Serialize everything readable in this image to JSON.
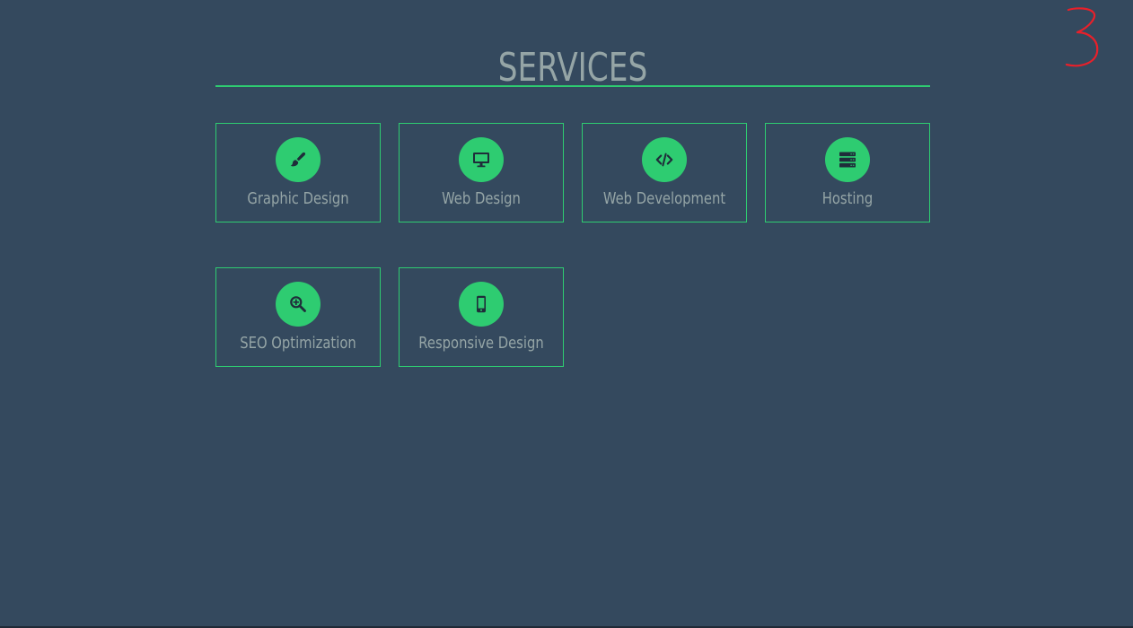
{
  "section": {
    "title": "SERVICES"
  },
  "services": [
    {
      "label": "Graphic Design",
      "icon": "paint-brush-icon"
    },
    {
      "label": "Web Design",
      "icon": "monitor-icon"
    },
    {
      "label": "Web Development",
      "icon": "code-icon"
    },
    {
      "label": "Hosting",
      "icon": "server-icon"
    },
    {
      "label": "SEO Optimization",
      "icon": "search-plus-icon"
    },
    {
      "label": "Responsive Design",
      "icon": "mobile-icon"
    }
  ],
  "colors": {
    "background": "#34495e",
    "accent": "#2ecc71",
    "text": "#95a5a6",
    "annotation": "#e8202a"
  }
}
